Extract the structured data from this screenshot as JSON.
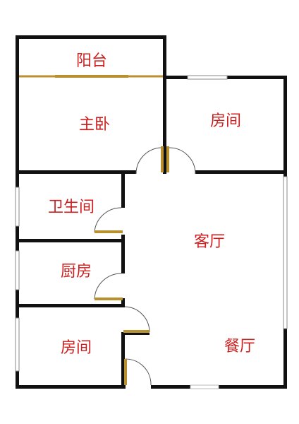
{
  "rooms": {
    "balcony": "阳台",
    "master_bedroom": "主卧",
    "bedroom_top_right": "房间",
    "bathroom": "卫生间",
    "living_room": "客厅",
    "kitchen": "厨房",
    "bedroom_bottom_left": "房间",
    "dining_room": "餐厅"
  },
  "colors": {
    "wall": "#111111",
    "label": "#cc1f1f",
    "door": "#b8902e",
    "window": "#8a8a8a"
  }
}
